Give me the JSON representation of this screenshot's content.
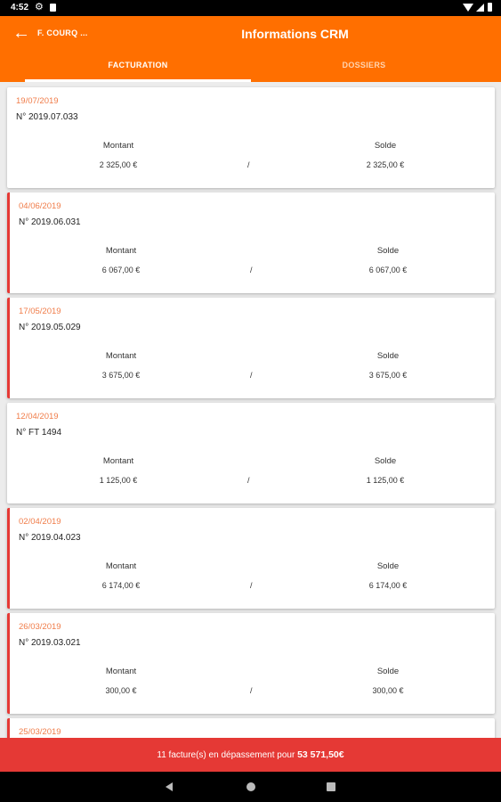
{
  "status": {
    "time": "4:52"
  },
  "header": {
    "back_label": "←",
    "client": "F. COURQ ...",
    "title": "Informations CRM"
  },
  "tabs": [
    {
      "label": "FACTURATION",
      "active": true
    },
    {
      "label": "DOSSIERS",
      "active": false
    }
  ],
  "labels": {
    "montant": "Montant",
    "solde": "Solde",
    "separator": "/"
  },
  "invoices": [
    {
      "date": "19/07/2019",
      "number": "N° 2019.07.033",
      "montant": "2 325,00 €",
      "solde": "2 325,00 €",
      "overdue": false
    },
    {
      "date": "04/06/2019",
      "number": "N° 2019.06.031",
      "montant": "6 067,00 €",
      "solde": "6 067,00 €",
      "overdue": true
    },
    {
      "date": "17/05/2019",
      "number": "N° 2019.05.029",
      "montant": "3 675,00 €",
      "solde": "3 675,00 €",
      "overdue": true
    },
    {
      "date": "12/04/2019",
      "number": "N° FT 1494",
      "montant": "1 125,00 €",
      "solde": "1 125,00 €",
      "overdue": false
    },
    {
      "date": "02/04/2019",
      "number": "N° 2019.04.023",
      "montant": "6 174,00 €",
      "solde": "6 174,00 €",
      "overdue": true
    },
    {
      "date": "26/03/2019",
      "number": "N° 2019.03.021",
      "montant": "300,00 €",
      "solde": "300,00 €",
      "overdue": true
    },
    {
      "date": "25/03/2019",
      "overdue": true
    }
  ],
  "summary": {
    "text": "11 facture(s) en dépassement pour ",
    "amount": "53 571,50€"
  },
  "colors": {
    "app_bar": "#ff6f00",
    "overdue": "#e53935",
    "date": "#f07d4a"
  }
}
